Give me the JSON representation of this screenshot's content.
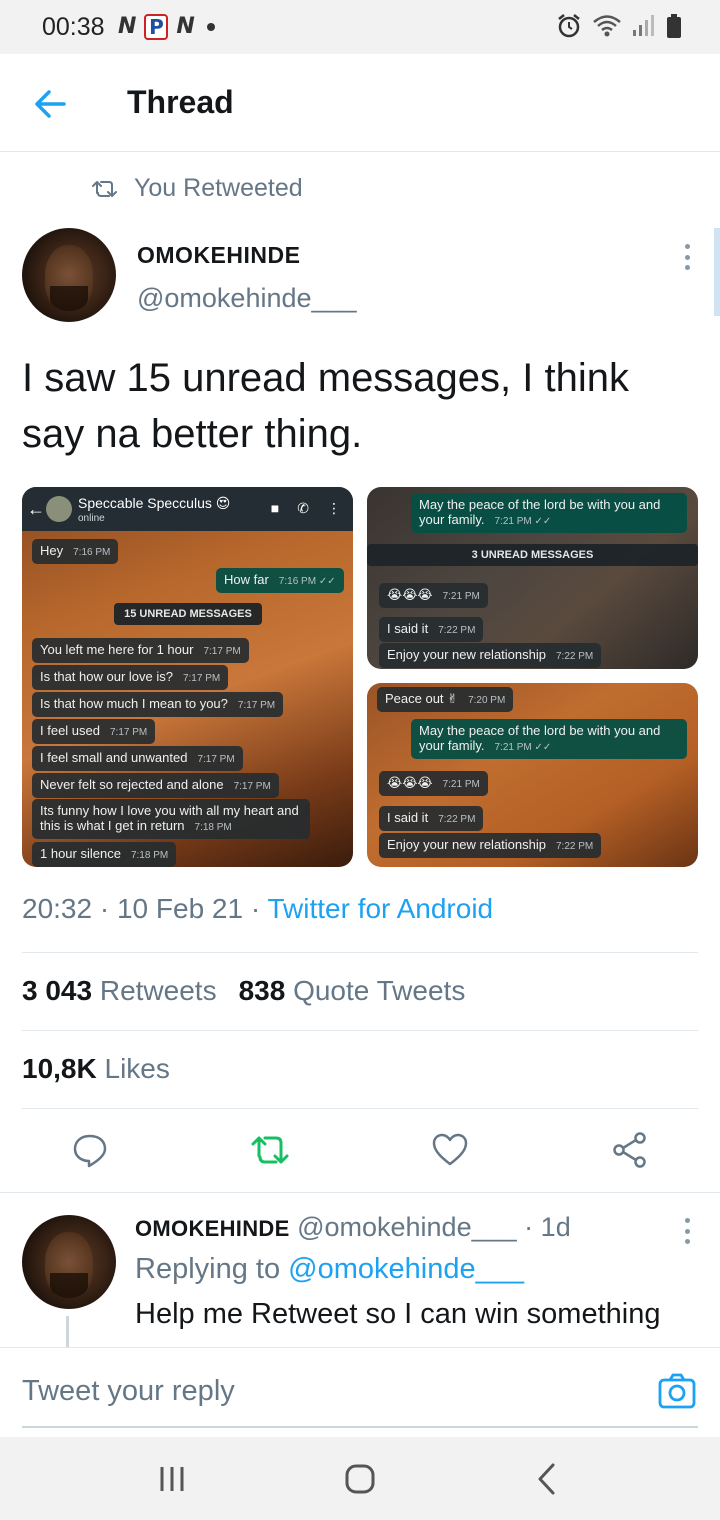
{
  "status_bar": {
    "time": "00:38",
    "left_icons": [
      "N",
      "P",
      "N"
    ]
  },
  "header": {
    "title": "Thread"
  },
  "retweet_context": {
    "label": "You Retweeted"
  },
  "tweet": {
    "author_name": "OMOKEHINDE",
    "author_handle": "@omokehinde___",
    "text": "I saw 15 unread messages, I think say na better thing.",
    "time": "20:32",
    "date": "10 Feb 21",
    "source": "Twitter for Android",
    "retweets_count": "3 043",
    "retweets_label": "Retweets",
    "quotes_count": "838",
    "quotes_label": "Quote Tweets",
    "likes_count": "10,8K",
    "likes_label": "Likes"
  },
  "media1": {
    "contact_name": "Speccable Specculus 😍",
    "contact_status": "online",
    "messages": [
      {
        "text": "Hey",
        "time": "7:16 PM"
      },
      {
        "text": "How far",
        "time": "7:16 PM ✓✓"
      },
      {
        "text": "15 UNREAD MESSAGES"
      },
      {
        "text": "You left me here for 1 hour",
        "time": "7:17 PM"
      },
      {
        "text": "Is that how our love is?",
        "time": "7:17 PM"
      },
      {
        "text": "Is that how much I mean to you?",
        "time": "7:17 PM"
      },
      {
        "text": "I feel used",
        "time": "7:17 PM"
      },
      {
        "text": "I feel small and unwanted",
        "time": "7:17 PM"
      },
      {
        "text": "Never felt so rejected and alone",
        "time": "7:17 PM"
      },
      {
        "text": "Its funny how I love you with all my heart and this is what I get in return",
        "time": "7:18 PM"
      },
      {
        "text": "1 hour silence",
        "time": "7:18 PM"
      }
    ]
  },
  "media2": {
    "messages": [
      {
        "text": "May the peace of the lord be with you and your family.",
        "time": "7:21 PM ✓✓"
      },
      {
        "text": "3 UNREAD MESSAGES"
      },
      {
        "text": "😭😭😭",
        "time": "7:21 PM"
      },
      {
        "text": "I said it",
        "time": "7:22 PM"
      },
      {
        "text": "Enjoy your new relationship",
        "time": "7:22 PM"
      }
    ]
  },
  "media3": {
    "messages": [
      {
        "text": "Peace out ✌",
        "time": "7:20 PM"
      },
      {
        "text": "May the peace of the lord be with you and your family.",
        "time": "7:21 PM ✓✓"
      },
      {
        "text": "😭😭😭",
        "time": "7:21 PM"
      },
      {
        "text": "I said it",
        "time": "7:22 PM"
      },
      {
        "text": "Enjoy your new relationship",
        "time": "7:22 PM"
      }
    ]
  },
  "reply": {
    "author_name": "OMOKEHINDE",
    "author_handle": "@omokehinde___",
    "age": "1d",
    "replying_to_label": "Replying to",
    "replying_to_handle": "@omokehinde___",
    "text": "Help me Retweet so I can win something"
  },
  "composer": {
    "placeholder": "Tweet your reply"
  },
  "colors": {
    "accent": "#1da1f2",
    "retweet_active": "#17bf63",
    "muted": "#657786"
  }
}
